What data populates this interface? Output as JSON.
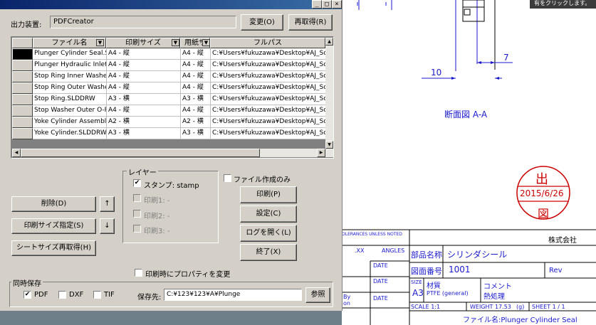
{
  "dialog": {
    "window_controls": {
      "minimize": "_",
      "maximize": "□",
      "close": "×"
    },
    "output_device": {
      "label": "出力装置:",
      "value": "PDFCreator",
      "change_button": "変更(O)",
      "reacquire_button": "再取得(R)"
    },
    "table": {
      "headers": [
        "ファイル名",
        "印刷サイズ",
        "用紙サ",
        "フルパス"
      ],
      "rows": [
        {
          "file": "Plunger Cylinder Seal.SL",
          "print": "A4 - 縦",
          "paper": "A4 - 縦",
          "path": "C:¥Users¥fukuzawa¥Desktop¥AJ_Soft"
        },
        {
          "file": "Plunger Hydraulic Inlet.S",
          "print": "A4 - 縦",
          "paper": "A4 - 縦",
          "path": "C:¥Users¥fukuzawa¥Desktop¥AJ_Soft"
        },
        {
          "file": "Stop Ring Inner Washer",
          "print": "A4 - 縦",
          "paper": "A4 - 縦",
          "path": "C:¥Users¥fukuzawa¥Desktop¥AJ_Soft"
        },
        {
          "file": "Stop Ring Outer Washer",
          "print": "A4 - 縦",
          "paper": "A4 - 縦",
          "path": "C:¥Users¥fukuzawa¥Desktop¥AJ_Soft"
        },
        {
          "file": "Stop Ring.SLDDRW",
          "print": "A3 - 横",
          "paper": "A3 - 横",
          "path": "C:¥Users¥fukuzawa¥Desktop¥AJ_Soft"
        },
        {
          "file": "Stop Washer Outer O-R",
          "print": "A4 - 縦",
          "paper": "A4 - 縦",
          "path": "C:¥Users¥fukuzawa¥Desktop¥AJ_Soft"
        },
        {
          "file": "Yoke Cylinder Assembl",
          "print": "A2 - 横",
          "paper": "A2 - 横",
          "path": "C:¥Users¥fukuzawa¥Desktop¥AJ_Soft"
        },
        {
          "file": "Yoke Cylinder.SLDDRW",
          "print": "A3 - 横",
          "paper": "A3 - 横",
          "path": "C:¥Users¥fukuzawa¥Desktop¥AJ_Soft"
        }
      ]
    },
    "layer": {
      "title": "レイヤー",
      "stamp": "スタンプ: stamp",
      "print1": "印刷1: -",
      "print2": "印刷2: -",
      "print3": "印刷3: -"
    },
    "file_create_only": "ファイル作成のみ",
    "buttons": {
      "delete": "削除(D)",
      "up": "↑",
      "down": "↓",
      "print_size": "印刷サイズ指定(S)",
      "sheet_size": "シートサイズ再取得(H)",
      "print": "印刷(P)",
      "settings": "設定(C)",
      "open_log": "ログを開く(L)",
      "exit": "終了(X)",
      "browse": "参照"
    },
    "change_property_on_print": "印刷時にプロパティを変更",
    "simultaneous_save": {
      "title": "同時保存",
      "pdf": "PDF",
      "dxf": "DXF",
      "tif": "TIF",
      "save_to_label": "保存先:",
      "save_to_value": "C:¥123¥123¥A¥Plunge"
    }
  },
  "drawing": {
    "notification": "有をクリックします。",
    "dim_7": "7",
    "dim_10": "10",
    "section_label": "断面図 A-A",
    "stamp": {
      "top": "出",
      "date": "2015/6/26",
      "bottom": "図"
    },
    "title_block": {
      "tolerance": "OLERANCES UNLESS NOTED",
      "xx": ".XX",
      "angles": "ANGLES",
      "date": "DATE",
      "by": "By",
      "on": "on",
      "company": "株式会社",
      "part_name_label": "部品名称",
      "part_name_value": "シリンダシール",
      "drawing_no_label": "図面番号",
      "drawing_no_value": "1001",
      "rev": "Rev",
      "size_label": "SIZE",
      "size_value": "A3",
      "material_label": "材質",
      "material_value": "PTFE (general)",
      "comment_label": "コメント",
      "comment_value": "熱処理",
      "scale": "SCALE  1:1",
      "weight": "WEIGHT  17.53",
      "unit": "(g)",
      "sheet": "SHEET   1 / 1",
      "filename": "ファイル名:Plunger Cylinder Seal"
    }
  }
}
